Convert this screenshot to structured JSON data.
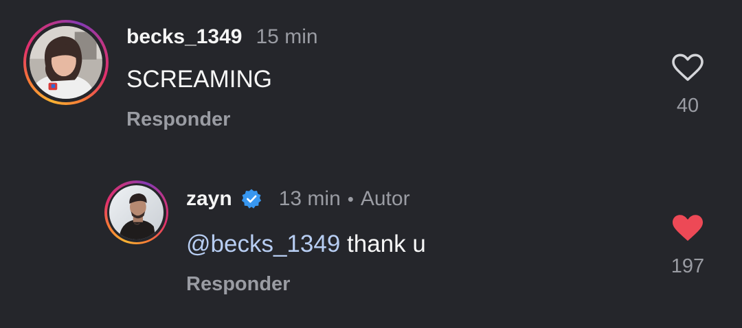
{
  "comments": [
    {
      "username": "becks_1349",
      "time": "15 min",
      "text": "SCREAMING",
      "reply_label": "Responder",
      "likes": "40",
      "liked": false
    },
    {
      "username": "zayn",
      "verified": true,
      "time": "13 min",
      "separator": "•",
      "author_label": "Autor",
      "mention": "@becks_1349",
      "text": " thank u",
      "reply_label": "Responder",
      "likes": "197",
      "liked": true
    }
  ],
  "colors": {
    "background": "#25262b",
    "secondary_text": "#9a9ca3",
    "mention": "#b7cdf2",
    "verified_badge": "#3897f0",
    "liked_heart": "#ed4956"
  },
  "icons": [
    "heart-outline-icon",
    "heart-filled-icon",
    "verified-badge-icon"
  ]
}
